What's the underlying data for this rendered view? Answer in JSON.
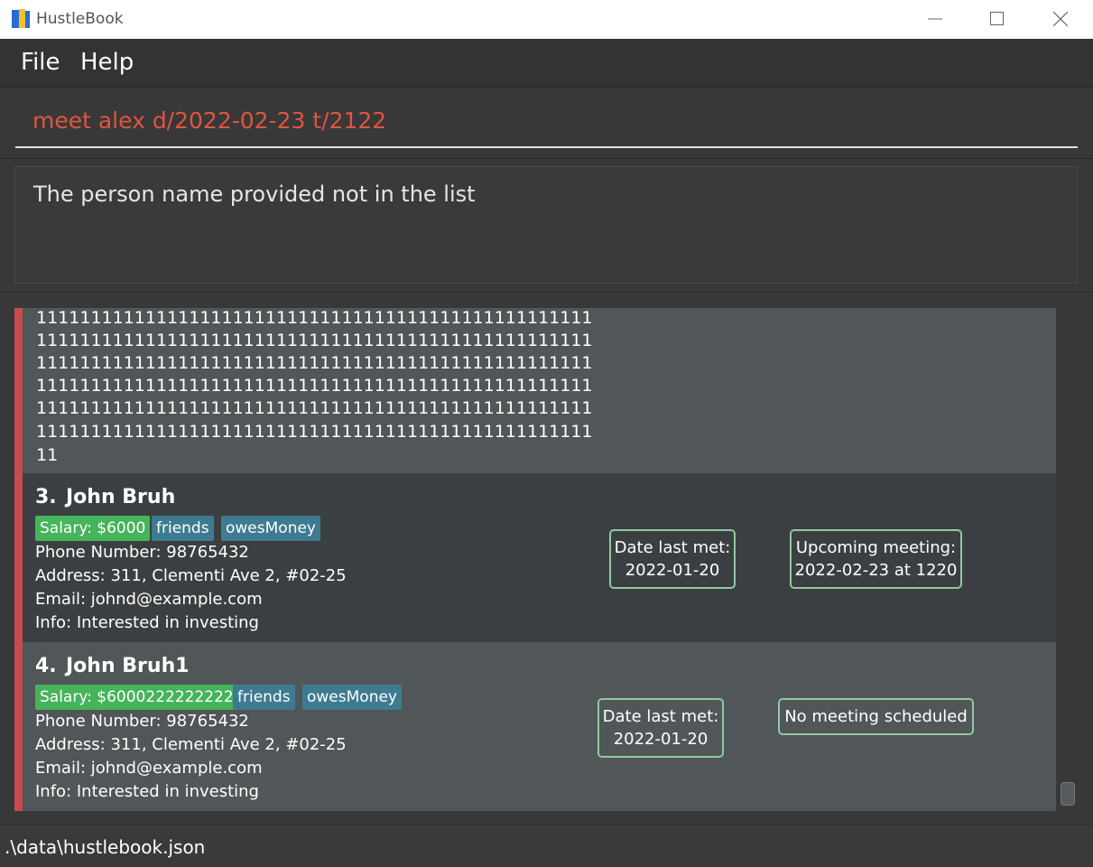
{
  "window": {
    "title": "HustleBook",
    "icon": "app-book-icon",
    "controls": [
      "minimize-icon",
      "maximize-icon",
      "close-icon"
    ]
  },
  "menu": {
    "items": [
      {
        "label": "File"
      },
      {
        "label": "Help"
      }
    ]
  },
  "command": {
    "value": "meet alex d/2022-02-23 t/2122",
    "error_color": "#e0553f"
  },
  "result": {
    "message": "The person name provided not in the list"
  },
  "list": {
    "accent_color": "#c54d4d",
    "partial_card_lines": [
      "111111111111111111111111111111111111111111111111111",
      "111111111111111111111111111111111111111111111111111",
      "111111111111111111111111111111111111111111111111111",
      "111111111111111111111111111111111111111111111111111",
      "111111111111111111111111111111111111111111111111111",
      "111111111111111111111111111111111111111111111111111",
      "11"
    ],
    "persons": [
      {
        "index": "3.",
        "name": "John Bruh",
        "tags": {
          "salary": "Salary: $6000",
          "t1": "friends",
          "t2": "owesMoney"
        },
        "phone": "Phone Number: 98765432",
        "address": "Address: 311, Clementi Ave 2, #02-25",
        "email": "Email: johnd@example.com",
        "info": "Info: Interested in investing",
        "last_met_label": "Date last met:",
        "last_met_date": "2022-01-20",
        "meeting_line1": "Upcoming meeting:",
        "meeting_line2": "2022-02-23 at 1220"
      },
      {
        "index": "4.",
        "name": "John Bruh1",
        "tags": {
          "salary": "Salary: $6000222222222",
          "t1": "friends",
          "t2": "owesMoney"
        },
        "phone": "Phone Number: 98765432",
        "address": "Address: 311, Clementi Ave 2, #02-25",
        "email": "Email: johnd@example.com",
        "info": "Info: Interested in investing",
        "last_met_label": "Date last met:",
        "last_met_date": "2022-01-20",
        "meeting_line1": "No meeting scheduled"
      }
    ]
  },
  "status": {
    "path": ".\\data\\hustlebook.json"
  }
}
